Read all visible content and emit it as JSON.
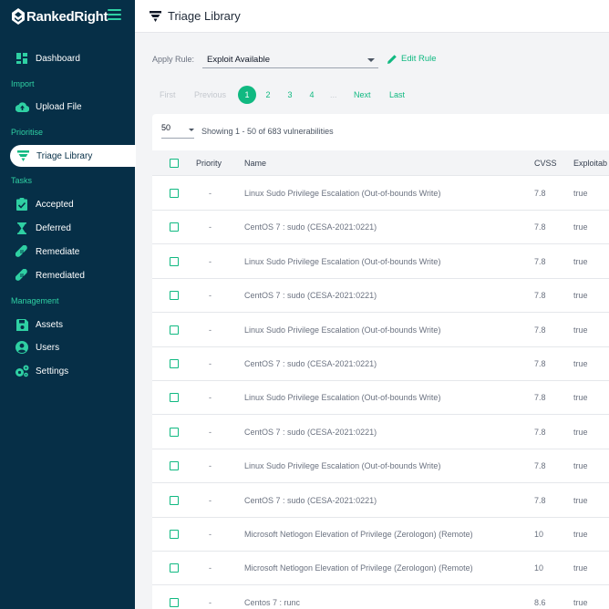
{
  "brand": {
    "name": "RankedRight"
  },
  "colors": {
    "sidebar": "#062f47",
    "accent": "#10b981",
    "accent_light": "#2fd0a3"
  },
  "sidebar": {
    "dashboard": {
      "label": "Dashboard",
      "icon": "dashboard-icon"
    },
    "section_import": "Import",
    "upload": {
      "label": "Upload File",
      "icon": "cloud-upload-icon"
    },
    "section_prioritise": "Prioritise",
    "triage": {
      "label": "Triage Library",
      "icon": "funnel-icon"
    },
    "section_tasks": "Tasks",
    "accepted": {
      "label": "Accepted",
      "icon": "clipboard-check-icon"
    },
    "deferred": {
      "label": "Deferred",
      "icon": "hourglass-icon"
    },
    "remediate": {
      "label": "Remediate",
      "icon": "bandage-icon"
    },
    "remediated": {
      "label": "Remediated",
      "icon": "bandage-icon"
    },
    "section_management": "Management",
    "assets": {
      "label": "Assets",
      "icon": "save-icon"
    },
    "users": {
      "label": "Users",
      "icon": "user-circle-icon"
    },
    "settings": {
      "label": "Settings",
      "icon": "gears-icon"
    }
  },
  "header": {
    "title": "Triage Library"
  },
  "rule": {
    "label": "Apply Rule:",
    "selected": "Exploit Available",
    "edit_label": "Edit Rule"
  },
  "pagination": {
    "first": "First",
    "previous": "Previous",
    "pages": [
      "1",
      "2",
      "3",
      "4"
    ],
    "current": "1",
    "ellipsis": "...",
    "next": "Next",
    "last": "Last"
  },
  "table": {
    "page_size": "50",
    "showing": "Showing 1 - 50 of 683 vulnerabilities",
    "columns": {
      "priority": "Priority",
      "name": "Name",
      "cvss": "CVSS",
      "exploitable": "Exploitab"
    },
    "rows": [
      {
        "priority": "-",
        "name": "Linux Sudo Privilege Escalation (Out-of-bounds Write)",
        "cvss": "7.8",
        "exploitable": "true"
      },
      {
        "priority": "-",
        "name": "CentOS 7 : sudo (CESA-2021:0221)",
        "cvss": "7.8",
        "exploitable": "true"
      },
      {
        "priority": "-",
        "name": "Linux Sudo Privilege Escalation (Out-of-bounds Write)",
        "cvss": "7.8",
        "exploitable": "true"
      },
      {
        "priority": "-",
        "name": "CentOS 7 : sudo (CESA-2021:0221)",
        "cvss": "7.8",
        "exploitable": "true"
      },
      {
        "priority": "-",
        "name": "Linux Sudo Privilege Escalation (Out-of-bounds Write)",
        "cvss": "7.8",
        "exploitable": "true"
      },
      {
        "priority": "-",
        "name": "CentOS 7 : sudo (CESA-2021:0221)",
        "cvss": "7.8",
        "exploitable": "true"
      },
      {
        "priority": "-",
        "name": "Linux Sudo Privilege Escalation (Out-of-bounds Write)",
        "cvss": "7.8",
        "exploitable": "true"
      },
      {
        "priority": "-",
        "name": "CentOS 7 : sudo (CESA-2021:0221)",
        "cvss": "7.8",
        "exploitable": "true"
      },
      {
        "priority": "-",
        "name": "Linux Sudo Privilege Escalation (Out-of-bounds Write)",
        "cvss": "7.8",
        "exploitable": "true"
      },
      {
        "priority": "-",
        "name": "CentOS 7 : sudo (CESA-2021:0221)",
        "cvss": "7.8",
        "exploitable": "true"
      },
      {
        "priority": "-",
        "name": "Microsoft Netlogon Elevation of Privilege (Zerologon) (Remote)",
        "cvss": "10",
        "exploitable": "true"
      },
      {
        "priority": "-",
        "name": "Microsoft Netlogon Elevation of Privilege (Zerologon) (Remote)",
        "cvss": "10",
        "exploitable": "true"
      },
      {
        "priority": "-",
        "name": "Centos 7 : runc",
        "cvss": "8.6",
        "exploitable": "true"
      }
    ]
  }
}
